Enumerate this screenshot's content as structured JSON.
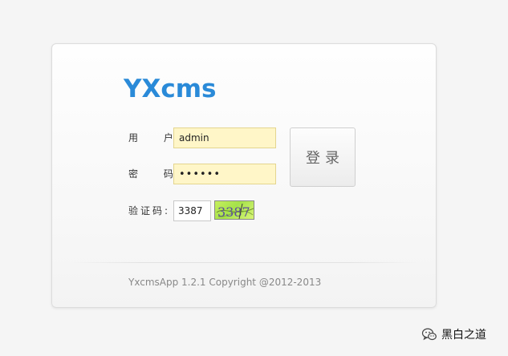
{
  "logo": "YXcms",
  "form": {
    "username_label": "用 户:",
    "username_value": "admin",
    "password_label": "密 码:",
    "password_value": "••••••",
    "captcha_label": "验证码:",
    "captcha_value": "3387",
    "captcha_image_text": "3387",
    "login_button": "登录"
  },
  "footer": {
    "copyright": "YxcmsApp 1.2.1 Copyright @2012-2013"
  },
  "watermark": {
    "icon": "wechat-icon",
    "text": "黑白之道"
  },
  "colors": {
    "logo": "#2a8ad8",
    "input_background": "#fff6c8",
    "captcha_background": "#b8ea55"
  }
}
